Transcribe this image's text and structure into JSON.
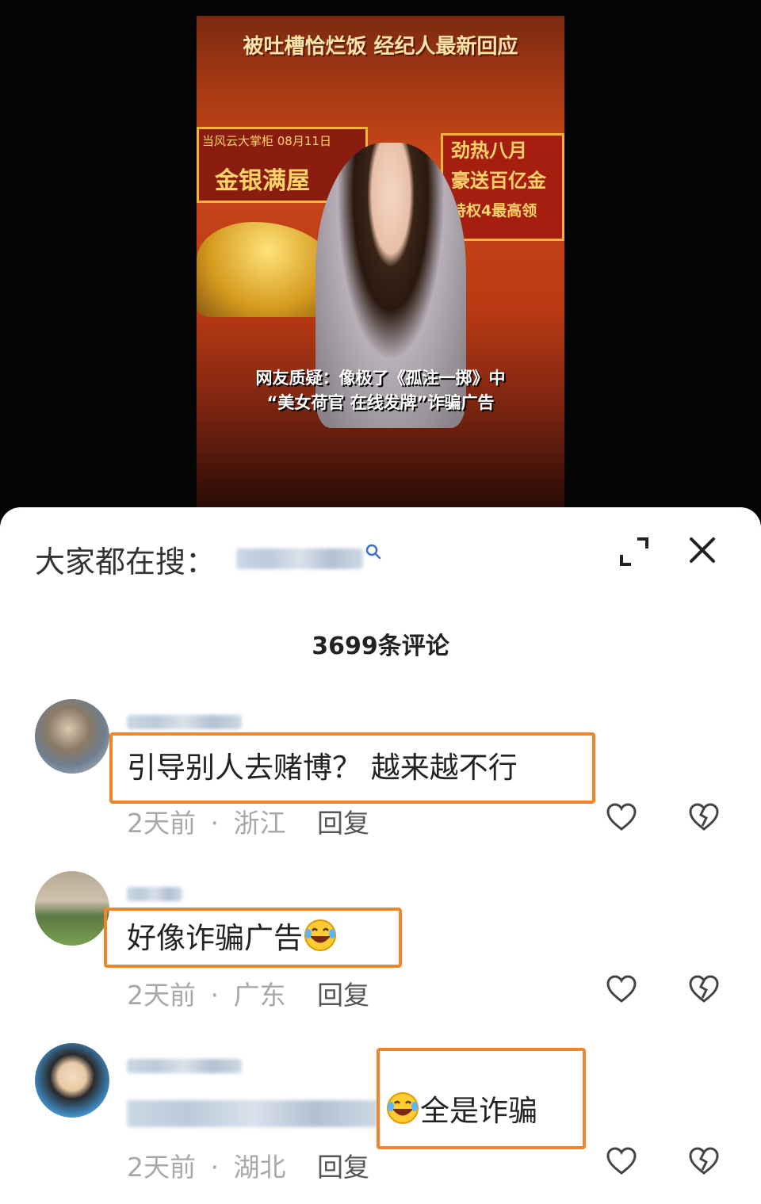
{
  "video": {
    "title": "被吐槽恰烂饭 经纪人最新回应",
    "banner_left_top": "当风云大掌柜 08月11日",
    "banner_left_main": "金银满屋",
    "banner_right_lines": [
      "劲热八月",
      "豪送百亿金",
      "特权4最高领"
    ],
    "caption_line1": "网友质疑：像极了《孤注一掷》中",
    "caption_line2": "“美女荷官 在线发牌”诈骗广告"
  },
  "search": {
    "label": "大家都在搜："
  },
  "comments_count": "3699条评论",
  "comments": [
    {
      "text": "引导别人去赌博？ 越来越不行",
      "time": "2天前",
      "region": "浙江",
      "reply": "回复"
    },
    {
      "text": "好像诈骗广告",
      "time": "2天前",
      "region": "广东",
      "reply": "回复"
    },
    {
      "text": "全是诈骗",
      "time": "2天前",
      "region": "湖北",
      "reply": "回复"
    }
  ],
  "meta_separator": "·",
  "colors": {
    "highlight": "#f0862c",
    "meta": "#a8a8a8",
    "sheet": "#ffffff"
  },
  "icons": [
    "search-icon",
    "expand-icon",
    "close-icon",
    "heart-icon",
    "broken-heart-icon",
    "rofl-emoji"
  ]
}
